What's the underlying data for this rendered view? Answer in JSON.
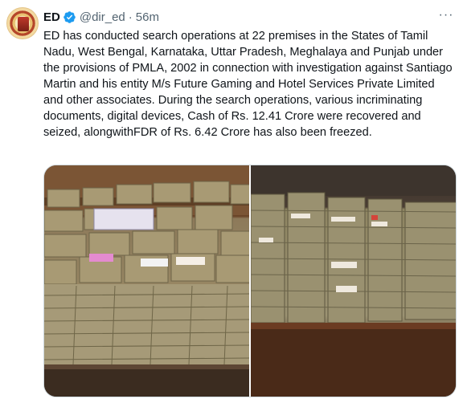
{
  "author": {
    "name": "ED",
    "handle": "@dir_ed",
    "separator": "·",
    "time": "56m",
    "verified_icon": "verified-badge-icon"
  },
  "menu_icon": "more-horizontal-icon",
  "menu_glyph": "···",
  "tweet": {
    "text": "ED has conducted search operations at 22 premises in the States of Tamil Nadu, West Bengal, Karnataka, Uttar Pradesh, Meghalaya and Punjab under the provisions of PMLA, 2002 in connection with investigation against Santiago Martin and his entity M/s Future Gaming and Hotel Services Private Limited and other associates. During the search operations, various incriminating documents, digital devices, Cash of Rs. 12.41 Crore were recovered and seized, alongwithFDR of Rs. 6.42 Crore has also been freezed."
  },
  "colors": {
    "verified": "#1d9bf0",
    "secondary_text": "#536471",
    "border": "#cfd9de"
  }
}
